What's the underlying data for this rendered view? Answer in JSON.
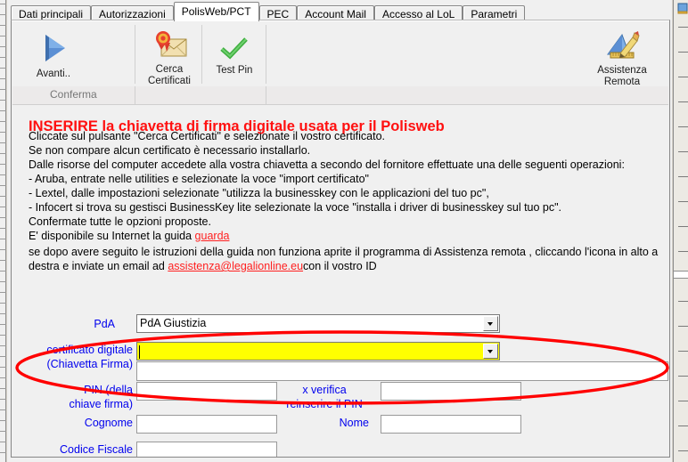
{
  "window": {
    "tabs": [
      {
        "label": "Dati principali",
        "active": false
      },
      {
        "label": "Autorizzazioni",
        "active": false
      },
      {
        "label": "PolisWeb/PCT",
        "active": true
      },
      {
        "label": "PEC",
        "active": false
      },
      {
        "label": "Account Mail",
        "active": false
      },
      {
        "label": "Accesso al LoL",
        "active": false
      },
      {
        "label": "Parametri",
        "active": false
      }
    ]
  },
  "toolbar": {
    "avanti_label": "Avanti..",
    "avanti_icon": "play-triangle-icon",
    "cerca_label_line1": "Cerca",
    "cerca_label_line2": "Certificati",
    "cerca_icon": "certificate-envelope-icon",
    "testpin_label": "Test Pin",
    "testpin_icon": "green-check-icon",
    "assistenza_label_line1": "Assistenza",
    "assistenza_label_line2": "Remota",
    "assistenza_icon": "ruler-pencil-icon",
    "group_caption": "Conferma"
  },
  "content": {
    "heading": "INSERIRE la chiavetta di firma digitale usata per il Polisweb",
    "lines": [
      "Cliccate sul pulsante \"Cerca Certificati\" e selezionate il vostro certificato.",
      "Se non compare alcun certificato è necessario installarlo.",
      "Dalle risorse del computer accedete alla vostra chiavetta a secondo del fornitore effettuate una delle seguenti operazioni:",
      "- Aruba, entrate nelle utilities e  selezionate la voce \"import certificato\"",
      "- Lextel, dalle impostazioni selezionate \"utilizza la businesskey con le applicazioni del tuo pc\",",
      "- Infocert si trova su gestisci BusinessKey lite selezionate la voce \"installa i driver di businesskey sul tuo pc\".",
      "Confermate tutte le opzioni proposte."
    ],
    "guide_prefix": "E' disponibile su Internet la guida ",
    "guide_link": "guarda",
    "support_line1": "se dopo avere seguito le istruzioni della guida non funziona aprite il programma di Assistenza remota , cliccando l'icona in alto a",
    "support_line2_prefix": "destra e inviate un email ad ",
    "support_email": "assistenza@legalionline.eu",
    "support_line2_suffix": "con il vostro ID"
  },
  "form": {
    "pda_label": "PdA",
    "pda_value": "PdA Giustizia",
    "cert_label_line1": "certificato digitale",
    "cert_label_line2": "(Chiavetta Firma)",
    "cert_value": "",
    "cert_detail_value": "",
    "pin_label_line1": "PIN (della",
    "pin_label_line2": "chiave firma)",
    "pin_value": "",
    "verify_label": "x verifica",
    "verify_sublabel": "reinserire il PIN",
    "verify_value": "",
    "cognome_label": "Cognome",
    "cognome_value": "",
    "nome_label": "Nome",
    "nome_value": "",
    "codice_fiscale_label": "Codice Fiscale",
    "codice_fiscale_value": ""
  },
  "annotation": {
    "name": "red-ellipse-highlight",
    "color": "#ff0000"
  },
  "colors": {
    "heading_red": "#ff1010",
    "label_blue": "#0000ee",
    "highlight_yellow": "#ffff00",
    "dialog_bg": "#f0f0f0"
  }
}
